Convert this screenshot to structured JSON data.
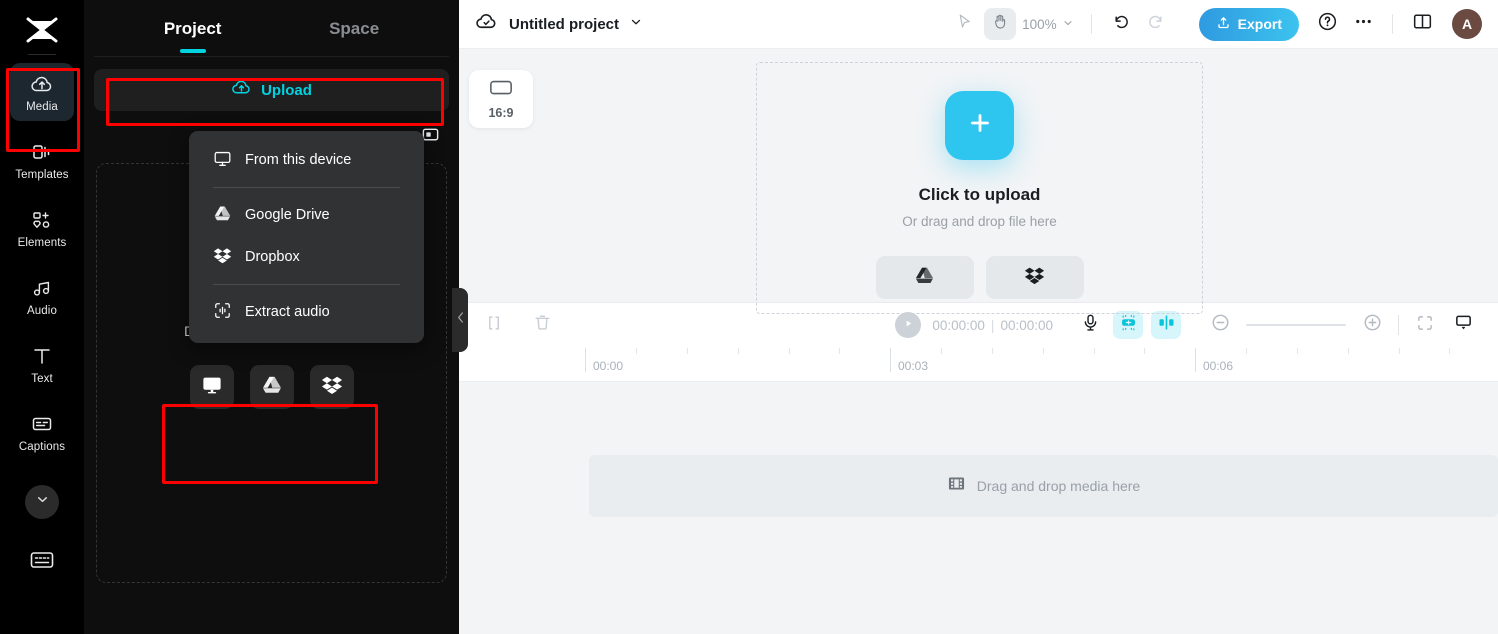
{
  "app": {
    "name": "CapCut Web Editor",
    "logo_icon": "capcut-logo-icon"
  },
  "rail": {
    "items": [
      {
        "id": "media",
        "label": "Media",
        "icon": "cloud-upload-icon",
        "active": true
      },
      {
        "id": "templates",
        "label": "Templates",
        "icon": "templates-icon",
        "active": false
      },
      {
        "id": "elements",
        "label": "Elements",
        "icon": "elements-icon",
        "active": false
      },
      {
        "id": "audio",
        "label": "Audio",
        "icon": "music-note-icon",
        "active": false
      },
      {
        "id": "text",
        "label": "Text",
        "icon": "text-t-icon",
        "active": false
      },
      {
        "id": "captions",
        "label": "Captions",
        "icon": "captions-icon",
        "active": false
      }
    ],
    "more_icon": "chevron-down-icon",
    "shortcuts_icon": "keyboard-icon"
  },
  "panel": {
    "tabs": [
      {
        "label": "Project",
        "active": true
      },
      {
        "label": "Space",
        "active": false
      }
    ],
    "upload_button": {
      "label": "Upload",
      "icon": "cloud-upload-icon",
      "accent": "#00d2e0"
    },
    "record_button": {
      "icon": "screen-record-icon"
    },
    "dropzone": {
      "text": "Drag and drop your files here",
      "sources": [
        {
          "id": "device",
          "icon": "monitor-icon"
        },
        {
          "id": "gdrive",
          "icon": "google-drive-icon"
        },
        {
          "id": "dropbox",
          "icon": "dropbox-icon"
        }
      ]
    },
    "upload_menu": {
      "items": [
        {
          "label": "From this device",
          "icon": "monitor-icon"
        },
        {
          "divider": true
        },
        {
          "label": "Google Drive",
          "icon": "google-drive-icon"
        },
        {
          "label": "Dropbox",
          "icon": "dropbox-icon"
        },
        {
          "divider": true
        },
        {
          "label": "Extract audio",
          "icon": "extract-audio-icon"
        }
      ]
    },
    "collapse_icon": "chevron-left-icon"
  },
  "topbar": {
    "cloud_icon": "cloud-saved-icon",
    "project_title": "Untitled project",
    "title_caret_icon": "chevron-down-icon",
    "select_tool_icon": "cursor-arrow-icon",
    "hand_tool_icon": "hand-icon",
    "zoom_level": "100%",
    "zoom_caret_icon": "chevron-down-icon",
    "undo_icon": "undo-icon",
    "redo_icon": "redo-icon",
    "export_label": "Export",
    "export_icon": "export-upload-icon",
    "help_icon": "question-circle-icon",
    "more_icon": "ellipsis-icon",
    "layout_icon": "split-layout-icon",
    "avatar_initial": "A",
    "avatar_color": "#6b4a42",
    "export_gradient_from": "#2f9ae0",
    "export_gradient_to": "#3cc3ee"
  },
  "stage": {
    "ratio_chip": {
      "label": "16:9",
      "icon": "aspect-ratio-icon"
    },
    "upload_card": {
      "plus_icon": "plus-icon",
      "plus_color": "#2ec5ef",
      "title": "Click to upload",
      "subtitle": "Or drag and drop file here",
      "buttons": [
        {
          "id": "gdrive",
          "icon": "google-drive-icon"
        },
        {
          "id": "dropbox",
          "icon": "dropbox-icon"
        }
      ]
    }
  },
  "timeline": {
    "split_icon": "split-clip-icon",
    "delete_icon": "trash-icon",
    "play_icon": "play-icon",
    "current_time": "00:00:00",
    "total_time": "00:00:00",
    "time_separator": "|",
    "mic_icon": "microphone-icon",
    "auto_edit_icon": "smart-tool-icon",
    "mirror_icon": "mirror-icon",
    "zoom_out_icon": "zoom-out-circle-icon",
    "zoom_in_icon": "zoom-in-circle-icon",
    "fit_icon": "fit-screen-icon",
    "preview_icon": "preview-drop-icon",
    "ruler_labels": [
      "00:00",
      "00:03",
      "00:06"
    ],
    "track_placeholder": {
      "icon": "film-strip-icon",
      "text": "Drag and drop media here"
    }
  },
  "highlights": {
    "color": "#ff0000",
    "boxes": [
      "media-rail-item",
      "upload-button",
      "dropzone-source-icons"
    ]
  }
}
